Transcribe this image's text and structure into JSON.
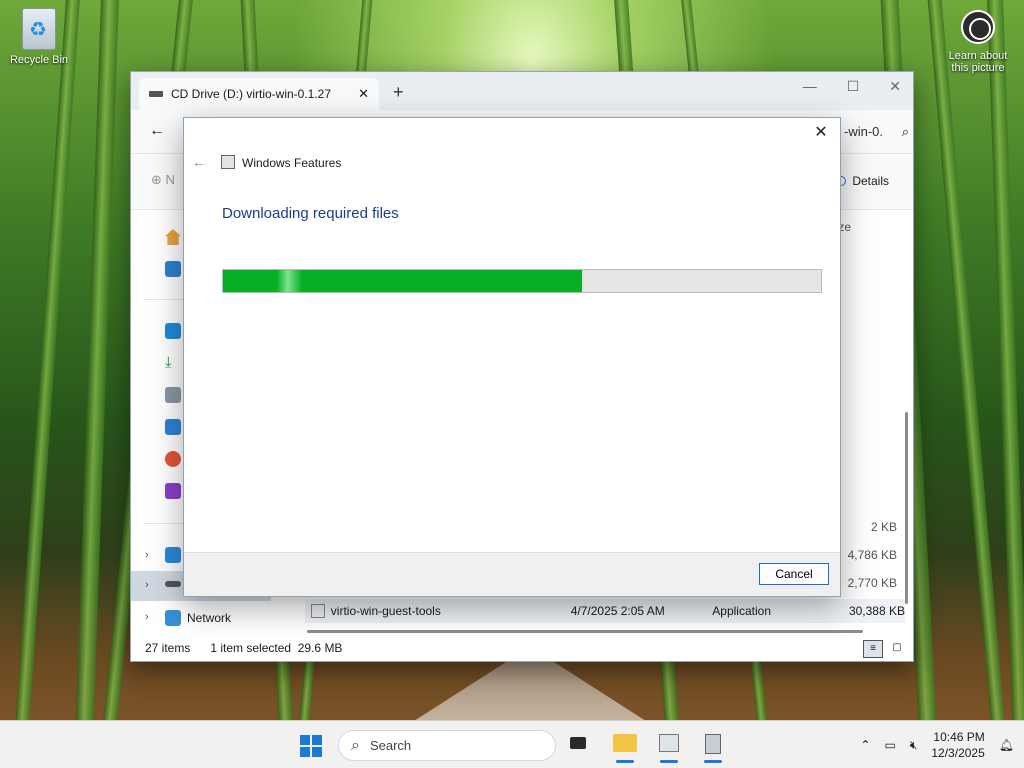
{
  "desktop": {
    "recycle_bin_label": "Recycle Bin",
    "learn_label_line1": "Learn about",
    "learn_label_line2": "this picture"
  },
  "explorer": {
    "tab_title": "CD Drive (D:) virtio-win-0.1.27",
    "address_tail": "-win-0.",
    "new_label": "N",
    "details_label": "Details",
    "size_header": "ze",
    "sidebar_network_label": "Network",
    "sizes": [
      "2 KB",
      "4,786 KB",
      "2,770 KB"
    ],
    "file_row": {
      "name": "virtio-win-guest-tools",
      "date": "4/7/2025 2:05 AM",
      "type": "Application",
      "size": "30,388 KB"
    },
    "status": {
      "item_count": "27 items",
      "selection": "1 item selected",
      "selection_size": "29.6 MB"
    }
  },
  "dialog": {
    "title": "Windows Features",
    "heading": "Downloading required files",
    "progress": 0.6,
    "cancel_label": "Cancel"
  },
  "taskbar": {
    "search_placeholder": "Search",
    "time": "10:46 PM",
    "date": "12/3/2025"
  },
  "colors": {
    "progress_fill": "#06b025",
    "accent": "#1a78d6",
    "heading": "#1a3e8c"
  }
}
